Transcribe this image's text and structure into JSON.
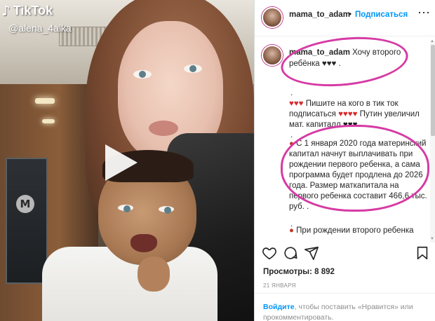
{
  "tiktok": {
    "logo": "TikTok",
    "username": "@alena_4aika",
    "play_icon": "play-icon"
  },
  "instagram": {
    "header": {
      "username": "mama_to_adam",
      "dot": "•",
      "follow": "Подписаться",
      "more": "⋯"
    },
    "caption": {
      "username": "mama_to_adam",
      "line1": "Хочу второго",
      "line2": "ребёнка ♥♥♥ ."
    },
    "paragraph2": {
      "lead": ".",
      "text": "Пишите на кого в тик ток подписаться",
      "text_after": "Путин увеличил мат. капиталл",
      "trailing": "."
    },
    "paragraph3": {
      "text": "С 1 января 2020 года материнский капитал начнут выплачивать при рождении первого ребенка, а сама программа будет продлена до 2026 года. Размер маткапитала на первого ребенка составит 466,6 тыс. руб. .",
      "trailing": "."
    },
    "paragraph4": {
      "text": "При рождении второго ребенка"
    },
    "likes_label": "Просмотры:",
    "likes_value": "8 892",
    "date": "21 ЯНВАРЯ",
    "footer": {
      "login_link": "Войдите",
      "login_text": ", чтобы поставить «Нравится» или прокомментировать."
    }
  },
  "colors": {
    "highlight": "#d63aa4",
    "link": "#0095f6",
    "heart": "#d62b2b"
  }
}
